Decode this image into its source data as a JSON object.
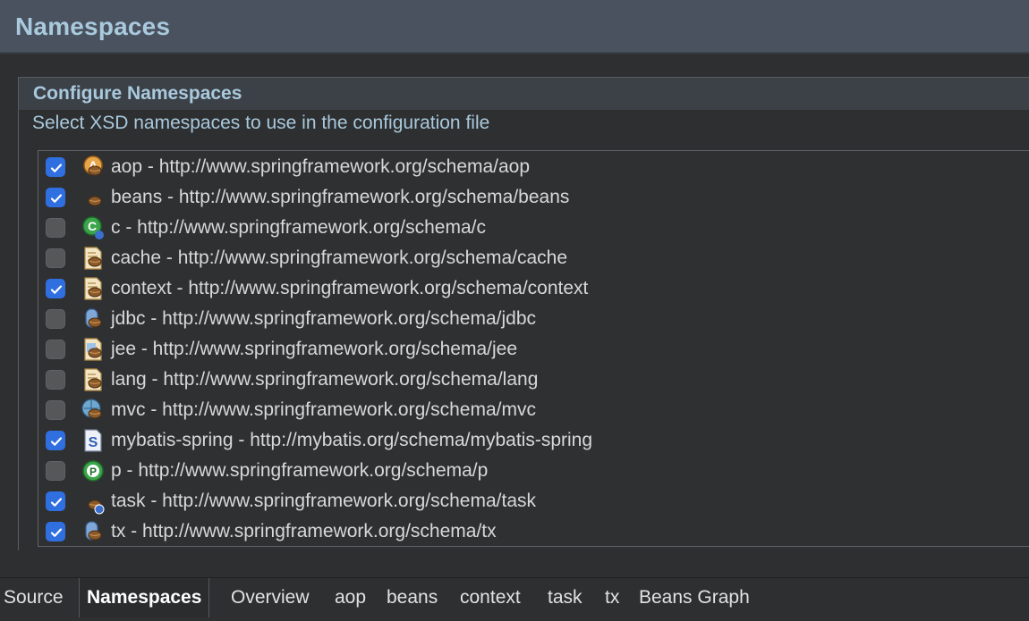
{
  "header": {
    "title": "Namespaces"
  },
  "section": {
    "title": "Configure Namespaces",
    "description": "Select XSD namespaces to use in the configuration file"
  },
  "namespaces": [
    {
      "label": "aop - http://www.springframework.org/schema/aop",
      "checked": true,
      "icon": "aop-icon"
    },
    {
      "label": "beans - http://www.springframework.org/schema/beans",
      "checked": true,
      "icon": "beans-icon"
    },
    {
      "label": "c - http://www.springframework.org/schema/c",
      "checked": false,
      "icon": "c-namespace-icon"
    },
    {
      "label": "cache - http://www.springframework.org/schema/cache",
      "checked": false,
      "icon": "cache-icon"
    },
    {
      "label": "context - http://www.springframework.org/schema/context",
      "checked": true,
      "icon": "context-icon"
    },
    {
      "label": "jdbc - http://www.springframework.org/schema/jdbc",
      "checked": false,
      "icon": "jdbc-icon"
    },
    {
      "label": "jee - http://www.springframework.org/schema/jee",
      "checked": false,
      "icon": "jee-icon"
    },
    {
      "label": "lang - http://www.springframework.org/schema/lang",
      "checked": false,
      "icon": "lang-icon"
    },
    {
      "label": "mvc - http://www.springframework.org/schema/mvc",
      "checked": false,
      "icon": "mvc-icon"
    },
    {
      "label": "mybatis-spring - http://mybatis.org/schema/mybatis-spring",
      "checked": true,
      "icon": "mybatis-icon"
    },
    {
      "label": "p - http://www.springframework.org/schema/p",
      "checked": false,
      "icon": "p-namespace-icon"
    },
    {
      "label": "task - http://www.springframework.org/schema/task",
      "checked": true,
      "icon": "task-icon"
    },
    {
      "label": "tx - http://www.springframework.org/schema/tx",
      "checked": true,
      "icon": "tx-icon"
    }
  ],
  "tabs": [
    {
      "label": "Source",
      "active": false
    },
    {
      "label": "Namespaces",
      "active": true
    },
    {
      "label": "Overview",
      "active": false
    },
    {
      "label": "aop",
      "active": false
    },
    {
      "label": "beans",
      "active": false
    },
    {
      "label": "context",
      "active": false
    },
    {
      "label": "task",
      "active": false
    },
    {
      "label": "tx",
      "active": false
    },
    {
      "label": "Beans Graph",
      "active": false
    }
  ],
  "colors": {
    "accent": "#2f6fe0",
    "title": "#a9c9dd",
    "background": "#2e2f31"
  }
}
